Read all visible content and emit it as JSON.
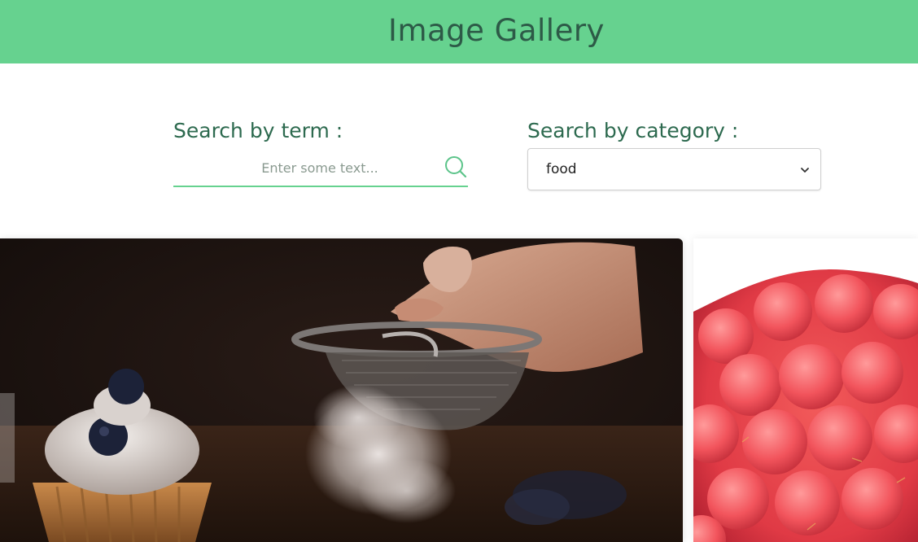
{
  "header": {
    "title": "Image Gallery"
  },
  "search": {
    "term_label": "Search by term :",
    "term_placeholder": "Enter some text...",
    "term_value": "",
    "category_label": "Search by category :",
    "category_value": "food"
  },
  "gallery": {
    "images": [
      {
        "subject": "sugar sifted over cupcakes",
        "icon": "photo"
      },
      {
        "subject": "raspberry close-up",
        "icon": "photo"
      }
    ]
  },
  "colors": {
    "accent": "#66d28f",
    "heading": "#2d6a4f",
    "title": "#2d5a47"
  }
}
